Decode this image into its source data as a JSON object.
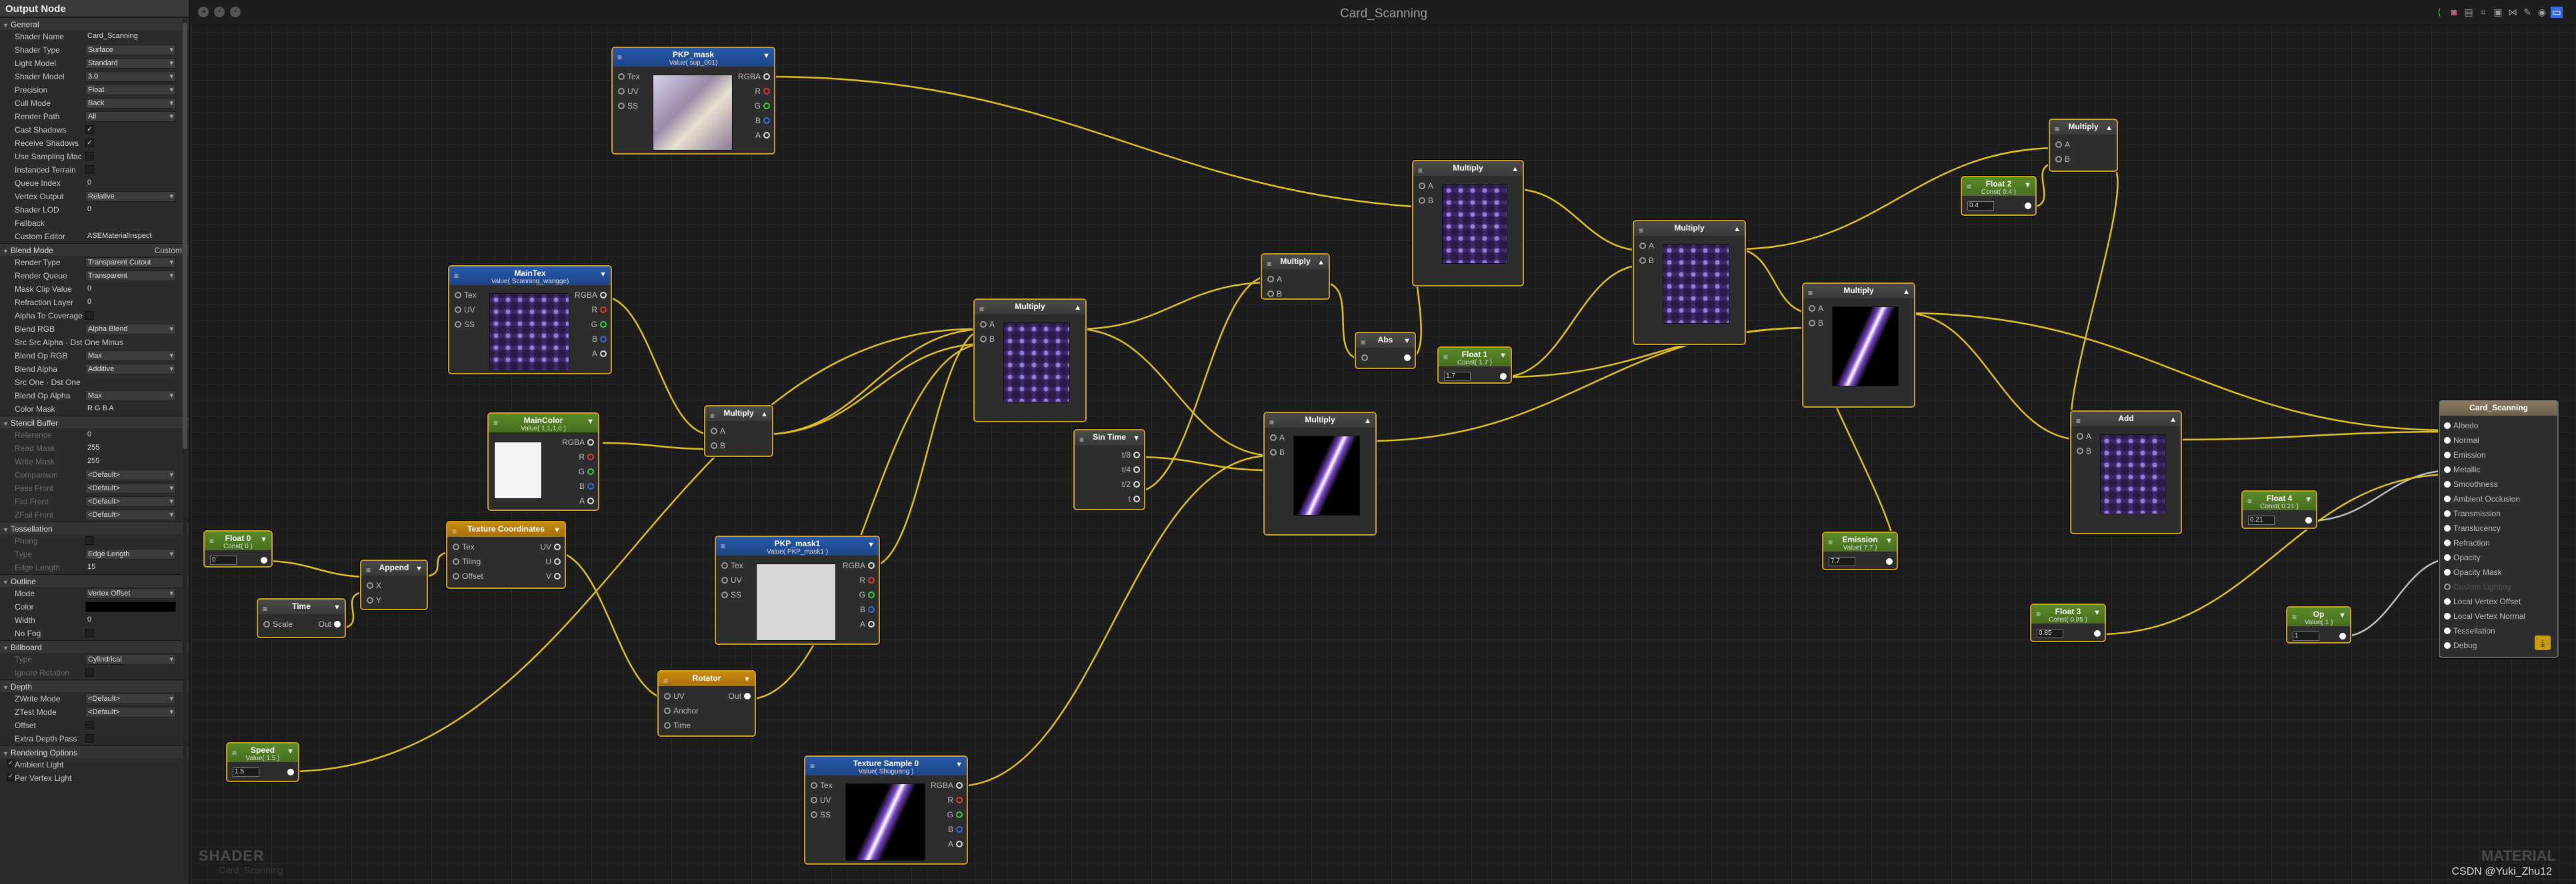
{
  "inspector": {
    "title": "Output Node",
    "general": {
      "header": "General",
      "rows": [
        {
          "label": "Shader Name",
          "value": "Card_Scanning",
          "kind": "txt"
        },
        {
          "label": "Shader Type",
          "value": "Surface",
          "kind": "dd"
        },
        {
          "label": "Light Model",
          "value": "Standard",
          "kind": "dd"
        },
        {
          "label": "Shader Model",
          "value": "3.0",
          "kind": "dd"
        },
        {
          "label": "Precision",
          "value": "Float",
          "kind": "dd"
        },
        {
          "label": "Cull Mode",
          "value": "Back",
          "kind": "dd"
        },
        {
          "label": "Render Path",
          "value": "All",
          "kind": "dd"
        },
        {
          "label": "Cast Shadows",
          "value": "✓",
          "kind": "chk"
        },
        {
          "label": "Receive Shadows",
          "value": "✓",
          "kind": "chk"
        },
        {
          "label": "Use Sampling Mac",
          "value": "",
          "kind": "chk"
        },
        {
          "label": "Instanced Terrain",
          "value": "",
          "kind": "chk"
        },
        {
          "label": "Queue Index",
          "value": "0",
          "kind": "txt"
        },
        {
          "label": "Vertex Output",
          "value": "Relative",
          "kind": "dd"
        },
        {
          "label": "Shader LOD",
          "value": "0",
          "kind": "txt"
        },
        {
          "label": "Fallback",
          "value": "",
          "kind": "txt"
        },
        {
          "label": "Custom Editor",
          "value": "ASEMaterialInspect",
          "kind": "txt"
        }
      ]
    },
    "blend": {
      "header": "Blend Mode",
      "right": "Custom",
      "rows": [
        {
          "label": "Render Type",
          "value": "Transparent Cutout",
          "kind": "dd"
        },
        {
          "label": "Render Queue",
          "value": "Transparent",
          "kind": "dd"
        },
        {
          "label": "Mask Clip Value",
          "value": "0",
          "kind": "txt"
        },
        {
          "label": "Refraction Layer",
          "value": "0",
          "kind": "txt"
        },
        {
          "label": "Alpha To Coverage",
          "value": "",
          "kind": "chk"
        },
        {
          "label": "Blend RGB",
          "value": "Alpha Blend",
          "kind": "dd"
        },
        {
          "label": "Src  Src Alpha  ·  Dst  One Minus",
          "value": "",
          "kind": "none"
        },
        {
          "label": "Blend Op RGB",
          "value": "Max",
          "kind": "dd"
        },
        {
          "label": "Blend Alpha",
          "value": "Additive",
          "kind": "dd"
        },
        {
          "label": "Src  One  ·  Dst  One",
          "value": "",
          "kind": "none"
        },
        {
          "label": "Blend Op Alpha",
          "value": "Max",
          "kind": "dd"
        },
        {
          "label": "Color Mask",
          "value": "R  G  B  A",
          "kind": "txt"
        }
      ]
    },
    "stencil": {
      "header": "Stencil Buffer",
      "rows": [
        {
          "label": "Reference",
          "value": "0",
          "kind": "txt"
        },
        {
          "label": "Read Mask",
          "value": "255",
          "kind": "txt"
        },
        {
          "label": "Write Mask",
          "value": "255",
          "kind": "txt"
        },
        {
          "label": "Comparison",
          "value": "<Default>",
          "kind": "dd"
        },
        {
          "label": "Pass Front",
          "value": "<Default>",
          "kind": "dd"
        },
        {
          "label": "Fail Front",
          "value": "<Default>",
          "kind": "dd"
        },
        {
          "label": "ZFail Front",
          "value": "<Default>",
          "kind": "dd"
        }
      ]
    },
    "tess": {
      "header": "Tessellation",
      "rows": [
        {
          "label": "Phong",
          "value": "",
          "kind": "chk"
        },
        {
          "label": "Type",
          "value": "Edge Length",
          "kind": "dd"
        },
        {
          "label": "Edge Length",
          "value": "15",
          "kind": "txt"
        }
      ]
    },
    "outline": {
      "header": "Outline",
      "rows": [
        {
          "label": "Mode",
          "value": "Vertex Offset",
          "kind": "dd"
        },
        {
          "label": "Color",
          "value": "",
          "kind": "txt"
        },
        {
          "label": "Width",
          "value": "0",
          "kind": "txt"
        },
        {
          "label": "No Fog",
          "value": "",
          "kind": "chk"
        }
      ]
    },
    "billboard": {
      "header": "Billboard",
      "rows": [
        {
          "label": "Type",
          "value": "Cylindrical",
          "kind": "dd"
        },
        {
          "label": "Ignore Rotation",
          "value": "",
          "kind": "chk"
        }
      ]
    },
    "depth": {
      "header": "Depth",
      "rows": [
        {
          "label": "ZWrite Mode",
          "value": "<Default>",
          "kind": "dd"
        },
        {
          "label": "ZTest Mode",
          "value": "<Default>",
          "kind": "dd"
        },
        {
          "label": "Offset",
          "value": "",
          "kind": "chk"
        },
        {
          "label": "Extra Depth Pass",
          "value": "",
          "kind": "chk"
        }
      ]
    },
    "rendering": {
      "header": "Rendering Options",
      "rows": [
        {
          "label": "Ambient Light",
          "value": "✓",
          "kind": "lchk"
        },
        {
          "label": "Per Vertex Light",
          "value": "✓",
          "kind": "lchk"
        }
      ]
    }
  },
  "canvas": {
    "title": "Card_Scanning",
    "footer_title": "SHADER",
    "footer_name": "Card_Scanning",
    "brand": "MATERIAL",
    "watermark": "CSDN @Yuki_Zhu12"
  },
  "nodes": {
    "pkp_mask": {
      "title": "PKP_mask",
      "sub": "Value( sup_001)",
      "in": [
        "Tex",
        "UV",
        "SS"
      ],
      "out": [
        "RGBA",
        "R",
        "G",
        "B",
        "A"
      ]
    },
    "maintex": {
      "title": "MainTex",
      "sub": "Value( Scanning_wangge)",
      "in": [
        "Tex",
        "UV",
        "SS"
      ],
      "out": [
        "RGBA",
        "R",
        "G",
        "B",
        "A"
      ]
    },
    "maincolor": {
      "title": "MainColor",
      "sub": "Value( 1,1,1,0 )",
      "out": [
        "RGBA",
        "R",
        "G",
        "B",
        "A"
      ]
    },
    "mul_small": {
      "title": "Multiply",
      "in": [
        "A",
        "B"
      ]
    },
    "mul_mid": {
      "title": "Multiply",
      "in": [
        "A",
        "B"
      ]
    },
    "mul_top": {
      "title": "Multiply",
      "in": [
        "A",
        "B"
      ]
    },
    "mul_up": {
      "title": "Multiply",
      "in": [
        "A",
        "B"
      ]
    },
    "abs": {
      "title": "Abs"
    },
    "float1": {
      "title": "Float 1",
      "sub": "Const( 1.7 )",
      "val": "1.7"
    },
    "mul_r1": {
      "title": "Multiply",
      "in": [
        "A",
        "B"
      ]
    },
    "mul_r2": {
      "title": "Multiply",
      "in": [
        "A",
        "B"
      ]
    },
    "mul_tr": {
      "title": "Multiply",
      "in": [
        "A",
        "B"
      ]
    },
    "float2": {
      "title": "Float 2",
      "sub": "Const( 0.4 )",
      "val": "0.4"
    },
    "sintime": {
      "title": "Sin Time",
      "out": [
        "t/8",
        "t/4",
        "t/2",
        "t"
      ]
    },
    "mul_beam": {
      "title": "Multiply",
      "in": [
        "A",
        "B"
      ]
    },
    "add": {
      "title": "Add",
      "in": [
        "A",
        "B"
      ]
    },
    "float4": {
      "title": "Float 4",
      "sub": "Const( 0.21 )",
      "val": "0.21"
    },
    "float0": {
      "title": "Float 0",
      "sub": "Const( 0 )",
      "val": "0"
    },
    "append": {
      "title": "Append",
      "in": [
        "X",
        "Y"
      ]
    },
    "time": {
      "title": "Time",
      "in": [
        "Scale"
      ],
      "out": "Out"
    },
    "texcoord": {
      "title": "Texture Coordinates",
      "in": [
        "Tex",
        "Tiling",
        "Offset"
      ],
      "out": [
        "UV",
        "U",
        "V"
      ]
    },
    "pkp_mask1": {
      "title": "PKP_mask1",
      "sub": "Value( PKP_mask1 )",
      "in": [
        "Tex",
        "UV",
        "SS"
      ],
      "out": [
        "RGBA",
        "R",
        "G",
        "B",
        "A"
      ]
    },
    "emission": {
      "title": "Emission",
      "sub": "Value( 7.7 )",
      "val": "7.7"
    },
    "rotator": {
      "title": "Rotator",
      "in": [
        "UV",
        "Anchor",
        "Time"
      ],
      "out": "Out"
    },
    "speed": {
      "title": "Speed",
      "sub": "Value( 1.5 )",
      "val": "1.5"
    },
    "texsample": {
      "title": "Texture Sample 0",
      "sub": "Value( Shuguang )",
      "in": [
        "Tex",
        "UV",
        "SS"
      ],
      "out": [
        "RGBA",
        "R",
        "G",
        "B",
        "A"
      ]
    },
    "float3": {
      "title": "Float 3",
      "sub": "Const( 0.85 )",
      "val": "0.85"
    },
    "op": {
      "title": "Op",
      "sub": "Value( 1 )",
      "val": "1"
    },
    "output": {
      "title": "Card_Scanning",
      "ports": [
        "Albedo",
        "Normal",
        "Emission",
        "Metallic",
        "Smoothness",
        "Ambient Occlusion",
        "Transmission",
        "Translucency",
        "Refraction",
        "Opacity",
        "Opacity Mask",
        "Custom Lighting",
        "Local Vertex Offset",
        "Local Vertex Normal",
        "Tessellation",
        "Debug"
      ]
    }
  },
  "colors": {
    "wire": "#e0c020",
    "accent": "#d4a018",
    "node_blue": "#2858a8",
    "node_green": "#5a8a28",
    "node_orange": "#c88a10"
  }
}
